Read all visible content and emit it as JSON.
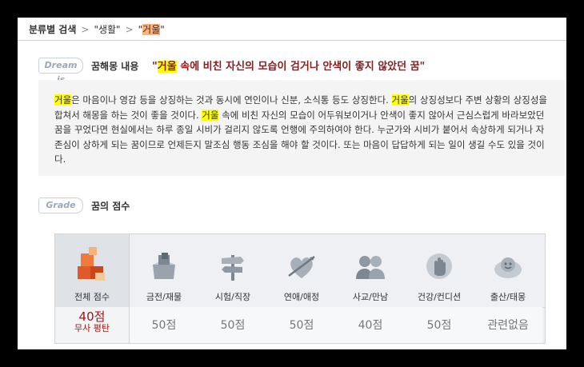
{
  "breadcrumb": {
    "root": "분류별 검색",
    "sep1": ">",
    "level1_label": "\"생활\"",
    "sep2": ">",
    "level2_prefix": "\"",
    "level2_keyword": "거울",
    "level2_suffix": "\""
  },
  "dream_section": {
    "tag": "Dream is",
    "label": "꿈해몽 내용",
    "title_open": "\"",
    "title_keyword": "거울",
    "title_rest": " 속에 비친 자신의 모습이 검거나 안색이 좋지 않았던 꿈\"",
    "description": {
      "k1": "거울",
      "t1": "은 마음이나 영감 등을 상징하는 것과 동시에 연인이나 신분, 소식통 등도 상징한다. ",
      "k2": "거울",
      "t2": "의 상징성보다 주변 상황의 상징성을 합쳐서 해몽을 하는 것이 좋을 것이다. ",
      "k3": "거울",
      "t3": " 속에 비친 자신의 모습이 어두워보이거나 안색이 좋지 않아서 근심스럽게 바라보았던 꿈을 꾸었다면 현실에서는 하루 종일 시비가 걸리지 않도록 언행에 주의하여야 한다. 누군가와 시비가 붙어서 속상하게 되거나 자존심이 상하게 되는 꿈이므로 언제든지 말조심 행동 조심을 해야 할 것이다. 또는 마음이 답답하게 되는 일이 생길 수도 있을 것이다."
    }
  },
  "grade_section": {
    "tag": "Grade",
    "label": "꿈의 점수",
    "total": {
      "label": "전체 점수",
      "score": "40점",
      "verdict": "무사 평탄",
      "icon": "blocks-icon"
    },
    "categories": [
      {
        "label": "금전/재물",
        "score": "50점",
        "icon": "money-box-icon"
      },
      {
        "label": "시험/직장",
        "score": "50점",
        "icon": "signpost-icon"
      },
      {
        "label": "연애/애정",
        "score": "50점",
        "icon": "heart-arrow-icon"
      },
      {
        "label": "사교/만남",
        "score": "40점",
        "icon": "people-icon"
      },
      {
        "label": "건강/컨디션",
        "score": "50점",
        "icon": "health-hand-icon"
      },
      {
        "label": "출산/태몽",
        "score": "관련없음",
        "icon": "baby-cloud-icon"
      }
    ]
  }
}
